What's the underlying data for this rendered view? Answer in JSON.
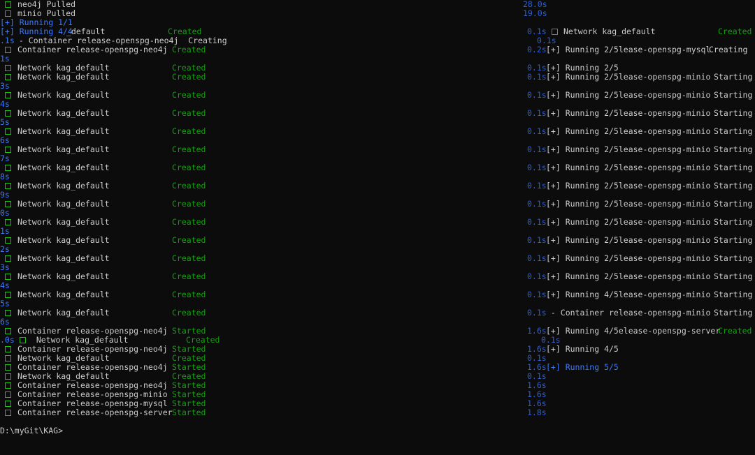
{
  "terminal": {
    "prompt": "D:\\myGit\\KAG>",
    "lines": [
      {
        "left_box": true,
        "left_prefix": "",
        "left_text": "neo4j Pulled",
        "left_status": "",
        "left_time": "28.0s",
        "right_box": false,
        "right_text": "",
        "right_status": ""
      },
      {
        "left_box": true,
        "left_prefix": "",
        "left_text": "minio Pulled",
        "left_status": "",
        "left_time": "19.0s",
        "right_box": false,
        "right_text": "",
        "right_status": ""
      },
      {
        "left_box": false,
        "left_prefix": "[+] Running 1/1",
        "left_text": "",
        "left_status": "",
        "left_time": "",
        "right_box": false,
        "right_text": "",
        "right_status": ""
      },
      {
        "left_box": false,
        "left_prefix": "[+] Running 4/4",
        "left_text": "_default",
        "left_status": "Created",
        "left_time": "0.1s",
        "right_box": true,
        "right_text": "Network kag_default",
        "right_status": "Created"
      },
      {
        "left_box": false,
        "left_prefix": ".1s",
        "left_text": " - Container release-openspg-neo4j  Creating",
        "left_status": "",
        "left_time": "0.1s",
        "right_box": false,
        "right_text": "",
        "right_status": ""
      },
      {
        "left_box": true,
        "left_prefix": "",
        "left_text": "Container release-openspg-neo4j",
        "left_status": "Created",
        "left_time": "0.2s",
        "right_box": false,
        "right_text": "[+] Running 2/5lease-openspg-mysql",
        "right_status": "Creating"
      },
      {
        "left_box": false,
        "left_prefix": "1s",
        "left_text": "",
        "left_status": "",
        "left_time": "",
        "right_box": false,
        "right_text": "",
        "right_status": ""
      },
      {
        "left_box": true,
        "left_prefix": "",
        "left_text": "Network kag_default",
        "left_status": "Created",
        "left_time": "0.1s",
        "right_box": false,
        "right_text": "[+] Running 2/5",
        "right_status": ""
      },
      {
        "left_box": true,
        "left_prefix": "",
        "left_text": "Network kag_default",
        "left_status": "Created",
        "left_time": "0.1s",
        "right_box": false,
        "right_text": "[+] Running 2/5lease-openspg-minio",
        "right_status": "Starting"
      },
      {
        "left_box": false,
        "left_prefix": "3s",
        "left_text": "",
        "left_status": "",
        "left_time": "",
        "right_box": false,
        "right_text": "",
        "right_status": ""
      },
      {
        "left_box": true,
        "left_prefix": "",
        "left_text": "Network kag_default",
        "left_status": "Created",
        "left_time": "0.1s",
        "right_box": false,
        "right_text": "[+] Running 2/5lease-openspg-minio",
        "right_status": "Starting"
      },
      {
        "left_box": false,
        "left_prefix": "4s",
        "left_text": "",
        "left_status": "",
        "left_time": "",
        "right_box": false,
        "right_text": "",
        "right_status": ""
      },
      {
        "left_box": true,
        "left_prefix": "",
        "left_text": "Network kag_default",
        "left_status": "Created",
        "left_time": "0.1s",
        "right_box": false,
        "right_text": "[+] Running 2/5lease-openspg-minio",
        "right_status": "Starting"
      },
      {
        "left_box": false,
        "left_prefix": "5s",
        "left_text": "",
        "left_status": "",
        "left_time": "",
        "right_box": false,
        "right_text": "",
        "right_status": ""
      },
      {
        "left_box": true,
        "left_prefix": "",
        "left_text": "Network kag_default",
        "left_status": "Created",
        "left_time": "0.1s",
        "right_box": false,
        "right_text": "[+] Running 2/5lease-openspg-minio",
        "right_status": "Starting"
      },
      {
        "left_box": false,
        "left_prefix": "6s",
        "left_text": "",
        "left_status": "",
        "left_time": "",
        "right_box": false,
        "right_text": "",
        "right_status": ""
      },
      {
        "left_box": true,
        "left_prefix": "",
        "left_text": "Network kag_default",
        "left_status": "Created",
        "left_time": "0.1s",
        "right_box": false,
        "right_text": "[+] Running 2/5lease-openspg-minio",
        "right_status": "Starting"
      },
      {
        "left_box": false,
        "left_prefix": "7s",
        "left_text": "",
        "left_status": "",
        "left_time": "",
        "right_box": false,
        "right_text": "",
        "right_status": ""
      },
      {
        "left_box": true,
        "left_prefix": "",
        "left_text": "Network kag_default",
        "left_status": "Created",
        "left_time": "0.1s",
        "right_box": false,
        "right_text": "[+] Running 2/5lease-openspg-minio",
        "right_status": "Starting"
      },
      {
        "left_box": false,
        "left_prefix": "8s",
        "left_text": "",
        "left_status": "",
        "left_time": "",
        "right_box": false,
        "right_text": "",
        "right_status": ""
      },
      {
        "left_box": true,
        "left_prefix": "",
        "left_text": "Network kag_default",
        "left_status": "Created",
        "left_time": "0.1s",
        "right_box": false,
        "right_text": "[+] Running 2/5lease-openspg-minio",
        "right_status": "Starting"
      },
      {
        "left_box": false,
        "left_prefix": "9s",
        "left_text": "",
        "left_status": "",
        "left_time": "",
        "right_box": false,
        "right_text": "",
        "right_status": ""
      },
      {
        "left_box": true,
        "left_prefix": "",
        "left_text": "Network kag_default",
        "left_status": "Created",
        "left_time": "0.1s",
        "right_box": false,
        "right_text": "[+] Running 2/5lease-openspg-minio",
        "right_status": "Starting"
      },
      {
        "left_box": false,
        "left_prefix": "0s",
        "left_text": "",
        "left_status": "",
        "left_time": "",
        "right_box": false,
        "right_text": "",
        "right_status": ""
      },
      {
        "left_box": true,
        "left_prefix": "",
        "left_text": "Network kag_default",
        "left_status": "Created",
        "left_time": "0.1s",
        "right_box": false,
        "right_text": "[+] Running 2/5lease-openspg-minio",
        "right_status": "Starting"
      },
      {
        "left_box": false,
        "left_prefix": "1s",
        "left_text": "",
        "left_status": "",
        "left_time": "",
        "right_box": false,
        "right_text": "",
        "right_status": ""
      },
      {
        "left_box": true,
        "left_prefix": "",
        "left_text": "Network kag_default",
        "left_status": "Created",
        "left_time": "0.1s",
        "right_box": false,
        "right_text": "[+] Running 2/5lease-openspg-minio",
        "right_status": "Starting"
      },
      {
        "left_box": false,
        "left_prefix": "2s",
        "left_text": "",
        "left_status": "",
        "left_time": "",
        "right_box": false,
        "right_text": "",
        "right_status": ""
      },
      {
        "left_box": true,
        "left_prefix": "",
        "left_text": "Network kag_default",
        "left_status": "Created",
        "left_time": "0.1s",
        "right_box": false,
        "right_text": "[+] Running 2/5lease-openspg-minio",
        "right_status": "Starting"
      },
      {
        "left_box": false,
        "left_prefix": "3s",
        "left_text": "",
        "left_status": "",
        "left_time": "",
        "right_box": false,
        "right_text": "",
        "right_status": ""
      },
      {
        "left_box": true,
        "left_prefix": "",
        "left_text": "Network kag_default",
        "left_status": "Created",
        "left_time": "0.1s",
        "right_box": false,
        "right_text": "[+] Running 2/5lease-openspg-minio",
        "right_status": "Starting"
      },
      {
        "left_box": false,
        "left_prefix": "4s",
        "left_text": "",
        "left_status": "",
        "left_time": "",
        "right_box": false,
        "right_text": "",
        "right_status": ""
      },
      {
        "left_box": true,
        "left_prefix": "",
        "left_text": "Network kag_default",
        "left_status": "Created",
        "left_time": "0.1s",
        "right_box": false,
        "right_text": "[+] Running 4/5lease-openspg-minio",
        "right_status": "Starting"
      },
      {
        "left_box": false,
        "left_prefix": "5s",
        "left_text": "",
        "left_status": "",
        "left_time": "",
        "right_box": false,
        "right_text": "",
        "right_status": ""
      },
      {
        "left_box": true,
        "left_prefix": "",
        "left_text": "Network kag_default",
        "left_status": "Created",
        "left_time": "0.1s",
        "right_box": false,
        "right_text": " - Container release-openspg-minio",
        "right_status": "Starting"
      },
      {
        "left_box": false,
        "left_prefix": "6s",
        "left_text": "",
        "left_status": "",
        "left_time": "",
        "right_box": false,
        "right_text": "",
        "right_status": ""
      },
      {
        "left_box": true,
        "left_prefix": "",
        "left_text": "Container release-openspg-neo4j",
        "left_status": "Started",
        "left_time": "1.6s",
        "right_box": false,
        "right_text": "[+] Running 4/5elease-openspg-server",
        "right_status": "Created"
      },
      {
        "left_box": false,
        "left_prefix": ".0s",
        "left_text": "  Network kag_default",
        "left_status": "Created",
        "left_time": "0.1s",
        "right_box": false,
        "right_text": "",
        "right_status": ""
      },
      {
        "left_box": true,
        "left_prefix": "",
        "left_text": "Container release-openspg-neo4j",
        "left_status": "Started",
        "left_time": "1.6s",
        "right_box": false,
        "right_text": "[+] Running 4/5",
        "right_status": ""
      },
      {
        "left_box": true,
        "left_prefix": "",
        "left_text": "Network kag_default",
        "left_status": "Created",
        "left_time": "0.1s",
        "right_box": false,
        "right_text": "",
        "right_status": ""
      },
      {
        "left_box": true,
        "left_prefix": "",
        "left_text": "Container release-openspg-neo4j",
        "left_status": "Started",
        "left_time": "1.6s",
        "right_box": false,
        "right_text": "[+] Running 5/5",
        "right_status": ""
      },
      {
        "left_box": true,
        "left_prefix": "",
        "left_text": "Network kag_default",
        "left_status": "Created",
        "left_time": "0.1s",
        "right_box": false,
        "right_text": "",
        "right_status": ""
      },
      {
        "left_box": true,
        "left_prefix": "",
        "left_text": "Container release-openspg-neo4j",
        "left_status": "Started",
        "left_time": "1.6s",
        "right_box": false,
        "right_text": "",
        "right_status": ""
      },
      {
        "left_box": true,
        "left_prefix": "",
        "left_text": "Container release-openspg-minio",
        "left_status": "Started",
        "left_time": "1.6s",
        "right_box": false,
        "right_text": "",
        "right_status": ""
      },
      {
        "left_box": true,
        "left_prefix": "",
        "left_text": "Container release-openspg-mysql",
        "left_status": "Started",
        "left_time": "1.6s",
        "right_box": false,
        "right_text": "",
        "right_status": ""
      },
      {
        "left_box": true,
        "left_prefix": "",
        "left_text": "Container release-openspg-server",
        "left_status": "Started",
        "left_time": "1.8s",
        "right_box": false,
        "right_text": "",
        "right_status": ""
      }
    ]
  }
}
